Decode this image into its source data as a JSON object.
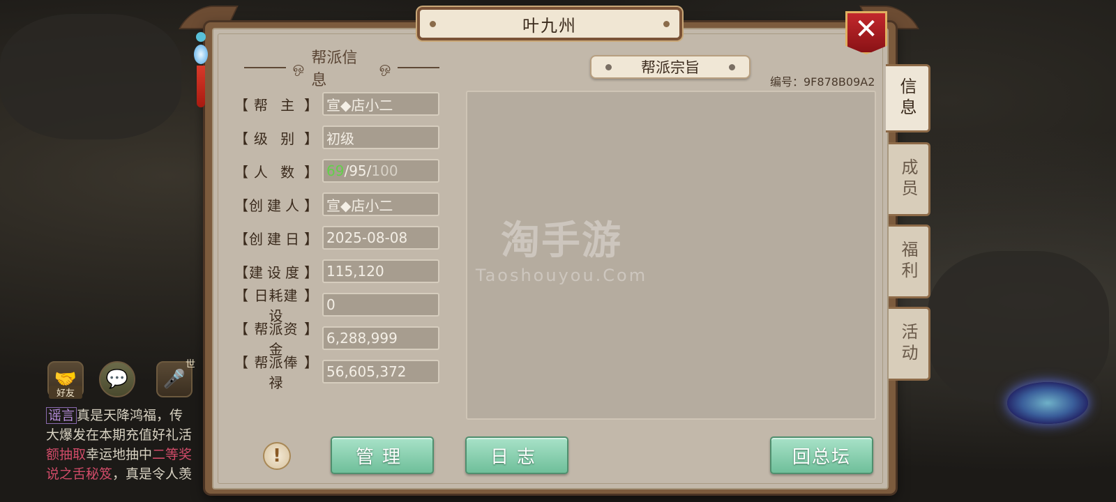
{
  "window": {
    "title": "叶九州"
  },
  "info_section": {
    "title": "帮派信息"
  },
  "info_rows": [
    {
      "label": "帮 主",
      "value": "宣◆店小二"
    },
    {
      "label": "级 别",
      "value": "初级"
    },
    {
      "label": "人 数",
      "members_current": "69",
      "members_active": "95",
      "members_max": "100"
    },
    {
      "label": "创建人",
      "value": "宣◆店小二"
    },
    {
      "label": "创建日",
      "value": "2025-08-08"
    },
    {
      "label": "建设度",
      "value": "115,120"
    },
    {
      "label": "日耗建设",
      "value": "0"
    },
    {
      "label": "帮派资金",
      "value": "6,288,999"
    },
    {
      "label": "帮派俸禄",
      "value": "56,605,372"
    }
  ],
  "purpose": {
    "title": "帮派宗旨",
    "guild_id": "编号：9F878B09A2",
    "text": ""
  },
  "watermark": {
    "cn": "淘手游",
    "en": "Taoshouyou.Com"
  },
  "buttons": {
    "info": "!",
    "manage": "管理",
    "log": "日志",
    "back": "回总坛"
  },
  "tabs": [
    {
      "label": "信息",
      "active": true
    },
    {
      "label": "成员",
      "active": false
    },
    {
      "label": "福利",
      "active": false
    },
    {
      "label": "活动",
      "active": false
    }
  ],
  "hud": {
    "friend_label": "好友",
    "voice_badge": "世",
    "chat_lines": [
      {
        "tag": "谣言",
        "text": "真是天降鸿福，传"
      },
      {
        "text": "大爆发在本期充值好礼活"
      },
      {
        "hl": "额抽取",
        "text": "幸运地抽中",
        "hl2": "二等奖"
      },
      {
        "hl": "说之舌秘笈",
        "text": "，真是令人羡"
      }
    ]
  },
  "colors": {
    "accent_green": "#63d04a",
    "button_green": "#8fd3b3",
    "close_red": "#b01e22"
  }
}
